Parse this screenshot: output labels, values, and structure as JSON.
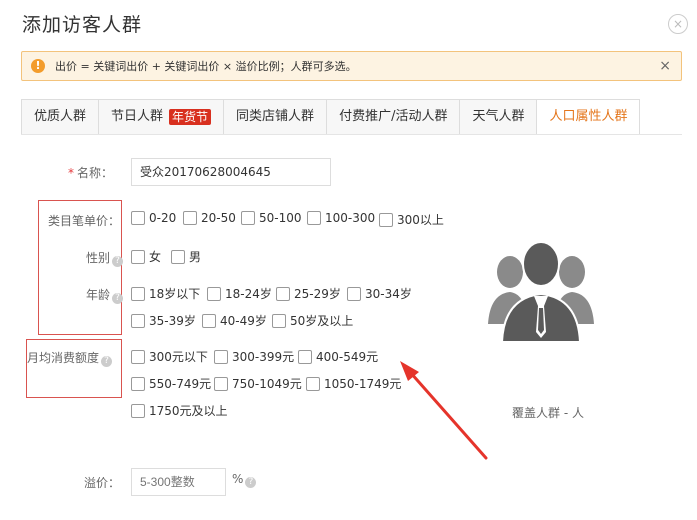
{
  "dialog": {
    "title": "添加访客人群",
    "close_icon": "×"
  },
  "notice": {
    "icon": "!",
    "text": "出价 = 关键词出价 + 关键词出价 × 溢价比例；人群可多选。",
    "close": "×"
  },
  "tabs": [
    {
      "label": "优质人群"
    },
    {
      "label": "节日人群",
      "badge": "年货节"
    },
    {
      "label": "同类店铺人群"
    },
    {
      "label": "付费推广/活动人群"
    },
    {
      "label": "天气人群"
    },
    {
      "label": "人口属性人群"
    }
  ],
  "form": {
    "name": {
      "required_mark": "*",
      "label": "名称：",
      "value": "受众20170628004645"
    },
    "category_price": {
      "label": "类目笔单价：",
      "options": [
        "0-20",
        "20-50",
        "50-100",
        "100-300",
        "300以上"
      ]
    },
    "gender": {
      "label": "性别",
      "help_icon": "?",
      "options": [
        "女",
        "男"
      ]
    },
    "age": {
      "label": "年龄",
      "help_icon": "?",
      "options": [
        "18岁以下",
        "18-24岁",
        "25-29岁",
        "30-34岁",
        "35-39岁",
        "40-49岁",
        "50岁及以上"
      ]
    },
    "monthly_spend": {
      "label": "月均消费额度",
      "help_icon": "?",
      "options": [
        "300元以下",
        "300-399元",
        "400-549元",
        "550-749元",
        "750-1049元",
        "1050-1749元",
        "1750元及以上"
      ]
    },
    "premium": {
      "label": "溢价：",
      "placeholder": "5-300整数",
      "unit": "%",
      "help_icon": "?"
    }
  },
  "coverage": {
    "text": "覆盖人群 - 人"
  },
  "colors": {
    "accent": "#e4761c",
    "warning": "#f39c2b",
    "highlight": "#d9534f",
    "badge": "#d8301f"
  }
}
